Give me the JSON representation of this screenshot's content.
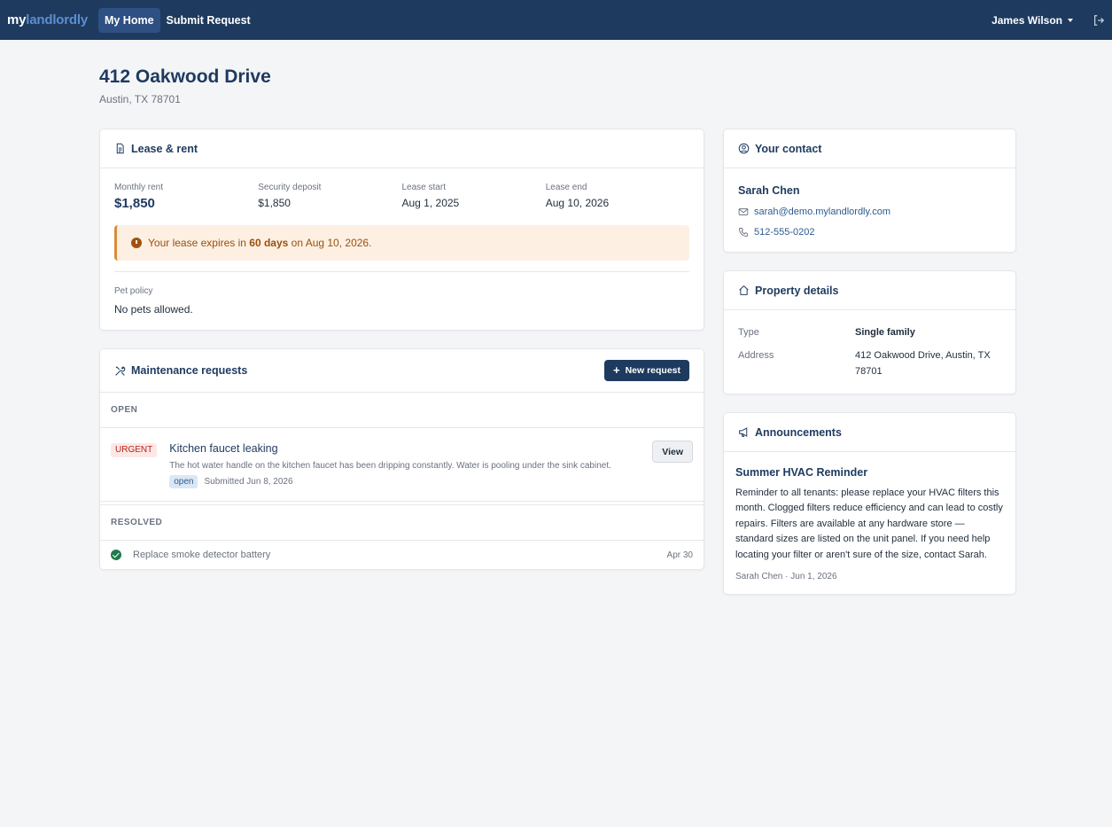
{
  "nav": {
    "brand_a": "my",
    "brand_b": "landlordly",
    "links": [
      "My Home",
      "Submit Request"
    ],
    "user": "James Wilson"
  },
  "property": {
    "title": "412 Oakwood Drive",
    "subtitle": "Austin, TX 78701"
  },
  "lease": {
    "header": "Lease & rent",
    "monthly_rent_label": "Monthly rent",
    "monthly_rent": "$1,850",
    "deposit_label": "Security deposit",
    "deposit": "$1,850",
    "start_label": "Lease start",
    "start": "Aug 1, 2025",
    "end_label": "Lease end",
    "end": "Aug 10, 2026",
    "alert_pre": "Your lease expires in ",
    "alert_days": "60 days",
    "alert_post": " on Aug 10, 2026.",
    "pet_label": "Pet policy",
    "pet": "No pets allowed."
  },
  "maintenance": {
    "header": "Maintenance requests",
    "new_button": "New request",
    "open_label": "OPEN",
    "resolved_label": "RESOLVED",
    "open_item": {
      "priority": "URGENT",
      "title": "Kitchen faucet leaking",
      "description": "The hot water handle on the kitchen faucet has been dripping constantly. Water is pooling under the sink cabinet.",
      "status": "open",
      "submitted": "Submitted Jun 8, 2026",
      "view_button": "View"
    },
    "resolved_item": {
      "title": "Replace smoke detector battery",
      "date": "Apr 30"
    }
  },
  "contact": {
    "header": "Your contact",
    "name": "Sarah Chen",
    "email": "sarah@demo.mylandlordly.com",
    "phone": "512-555-0202"
  },
  "details": {
    "header": "Property details",
    "type_label": "Type",
    "type": "Single family",
    "address_label": "Address",
    "address": "412 Oakwood Drive, Austin, TX 78701"
  },
  "announcements": {
    "header": "Announcements",
    "title": "Summer HVAC Reminder",
    "body": "Reminder to all tenants: please replace your HVAC filters this month. Clogged filters reduce efficiency and can lead to costly repairs. Filters are available at any hardware store — standard sizes are listed on the unit panel. If you need help locating your filter or aren't sure of the size, contact Sarah.",
    "meta": "Sarah Chen · Jun 1, 2026"
  },
  "colors": {
    "nav_bg": "#1e3a5f",
    "accent": "#2f5a8f",
    "urgent": "#b42318",
    "alert_bg": "#fdf0e2",
    "resolved": "#1f7a4c"
  }
}
